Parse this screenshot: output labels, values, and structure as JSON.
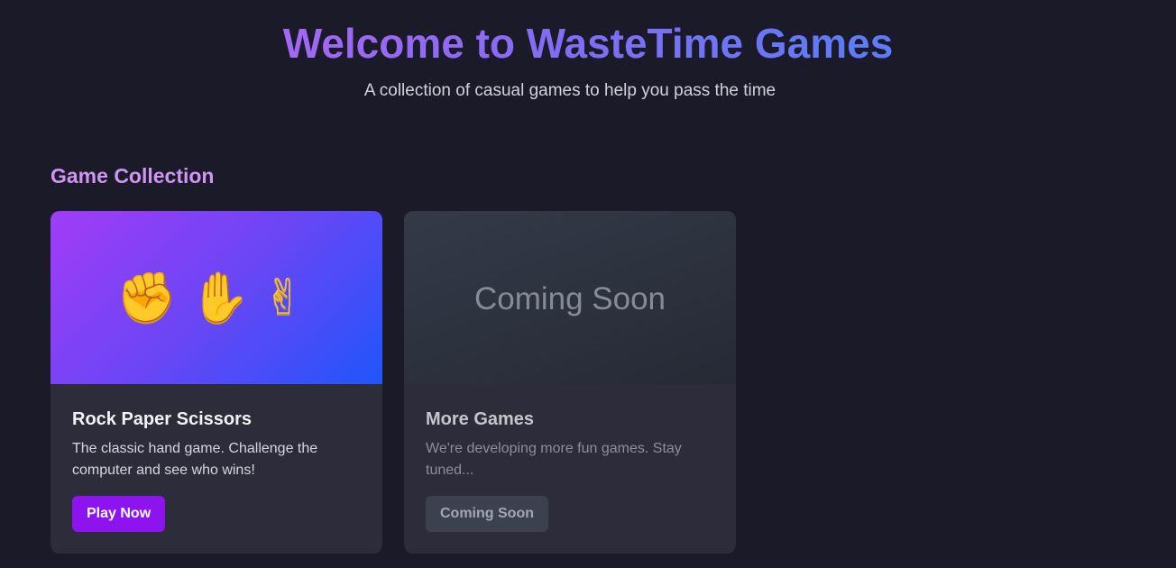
{
  "header": {
    "title": "Welcome to WasteTime Games",
    "subtitle": "A collection of casual games to help you pass the time"
  },
  "section": {
    "heading": "Game Collection"
  },
  "games": [
    {
      "banner_icons": [
        "✊",
        "✋",
        "✌"
      ],
      "title": "Rock Paper Scissors",
      "description": "The classic hand game. Challenge the computer and see who wins!",
      "button_label": "Play Now"
    },
    {
      "banner_text": "Coming Soon",
      "title": "More Games",
      "description": "We're developing more fun games. Stay tuned...",
      "button_label": "Coming Soon"
    }
  ],
  "colors": {
    "background": "#1b1a29",
    "accent_purple": "#8d14ee",
    "heading_lilac": "#cf95f2",
    "card_background": "#2d2c3a"
  }
}
